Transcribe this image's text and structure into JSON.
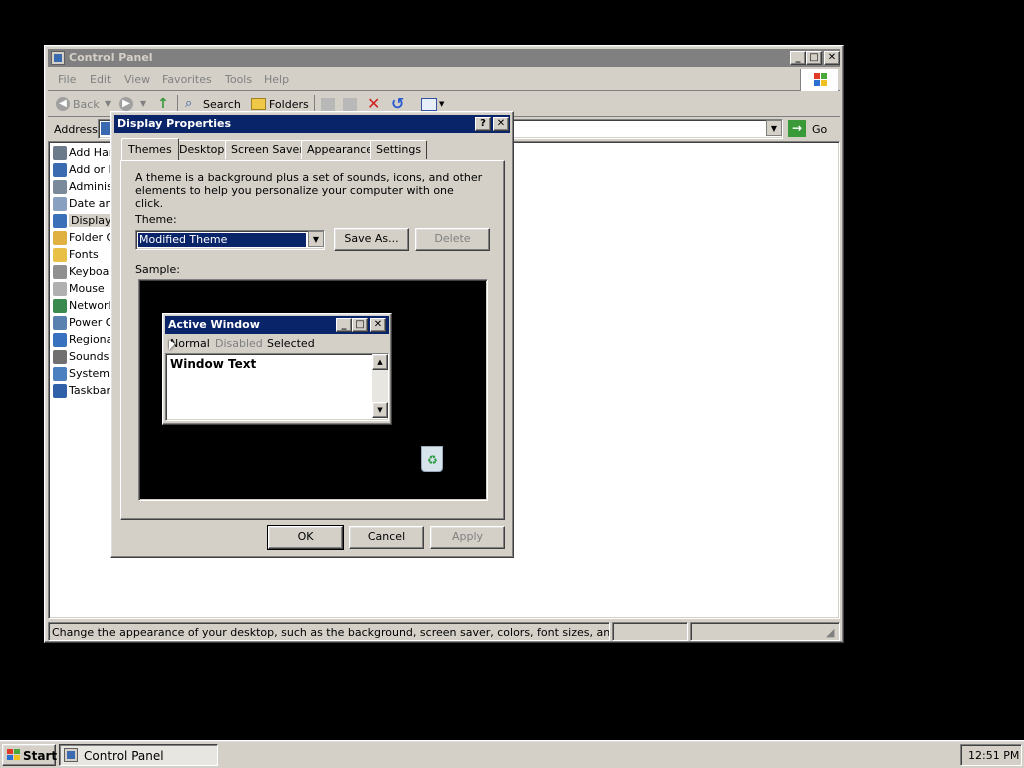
{
  "explorer": {
    "title": "Control Panel",
    "menu": [
      "File",
      "Edit",
      "View",
      "Favorites",
      "Tools",
      "Help"
    ],
    "toolbar": {
      "back": "Back",
      "search": "Search",
      "folders": "Folders"
    },
    "address_label": "Address",
    "go_label": "Go",
    "items": [
      {
        "label": "Add Hard",
        "color": "#6b7b8c"
      },
      {
        "label": "Add or R",
        "color": "#3a6ab0"
      },
      {
        "label": "Administ",
        "color": "#7a8a9a"
      },
      {
        "label": "Date and",
        "color": "#8aa0c0"
      },
      {
        "label": "Display",
        "color": "#3a70b8"
      },
      {
        "label": "Folder Op",
        "color": "#e0b040"
      },
      {
        "label": "Fonts",
        "color": "#e8c048"
      },
      {
        "label": "Keyboard",
        "color": "#909090"
      },
      {
        "label": "Mouse",
        "color": "#b0b0b0"
      },
      {
        "label": "Network",
        "color": "#3a8a50"
      },
      {
        "label": "Power Op",
        "color": "#5a80b0"
      },
      {
        "label": "Regional",
        "color": "#3a70c0"
      },
      {
        "label": "Sounds a",
        "color": "#707070"
      },
      {
        "label": "System",
        "color": "#4a80c0"
      },
      {
        "label": "Taskbar a",
        "color": "#3060a8"
      }
    ],
    "status": "Change the appearance of your desktop, such as the background, screen saver, colors, font sizes, and screen reso"
  },
  "dialog": {
    "title": "Display Properties",
    "tabs": [
      "Themes",
      "Desktop",
      "Screen Saver",
      "Appearance",
      "Settings"
    ],
    "description": "A theme is a background plus a set of sounds, icons, and other elements to help you personalize your computer with one click.",
    "theme_label": "Theme:",
    "theme_value": "Modified Theme",
    "save_as": "Save As...",
    "delete": "Delete",
    "sample_label": "Sample:",
    "sample": {
      "window_title": "Active Window",
      "menu": [
        "Normal",
        "Disabled",
        "Selected"
      ],
      "window_text": "Window Text"
    },
    "ok": "OK",
    "cancel": "Cancel",
    "apply": "Apply"
  },
  "taskbar": {
    "start": "Start",
    "task": "Control Panel",
    "clock": "12:51 PM"
  }
}
